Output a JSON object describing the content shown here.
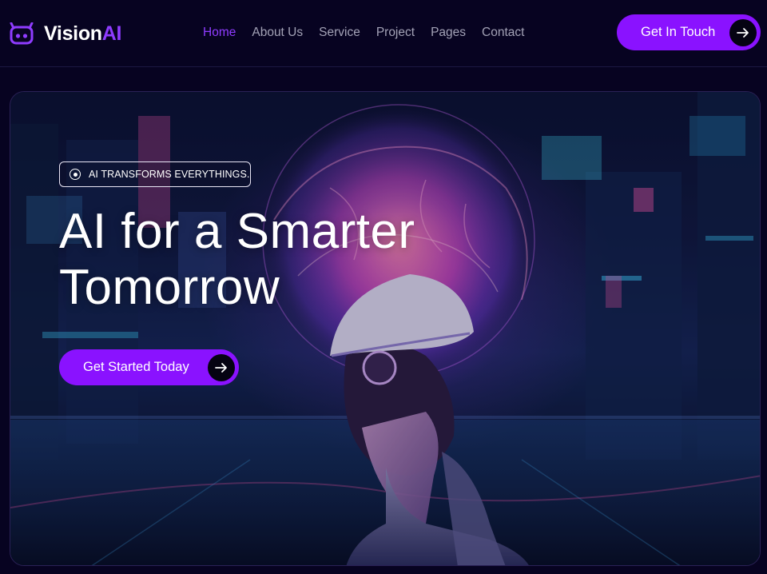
{
  "brand": {
    "name_main": "Vision",
    "name_accent": "AI",
    "logo_icon": "robot-icon",
    "accent_color": "#8a12ff"
  },
  "nav": {
    "items": [
      {
        "label": "Home",
        "active": true
      },
      {
        "label": "About Us",
        "active": false
      },
      {
        "label": "Service",
        "active": false
      },
      {
        "label": "Project",
        "active": false
      },
      {
        "label": "Pages",
        "active": false
      },
      {
        "label": "Contact",
        "active": false
      }
    ]
  },
  "header_cta": {
    "label": "Get In Touch",
    "icon": "arrow-right-icon"
  },
  "hero": {
    "tag": "AI TRANSFORMS EVERYTHINGS.",
    "title_line1": "AI for a Smarter",
    "title_line2": "Tomorrow",
    "button_label": "Get Started Today",
    "button_icon": "arrow-right-icon",
    "background": "futuristic city with glowing brain and woman in VR headset"
  },
  "colors": {
    "page_bg": "#070321",
    "nav_text": "#a3a2b6",
    "nav_active": "#8f3cff",
    "button": "#8a12ff"
  }
}
